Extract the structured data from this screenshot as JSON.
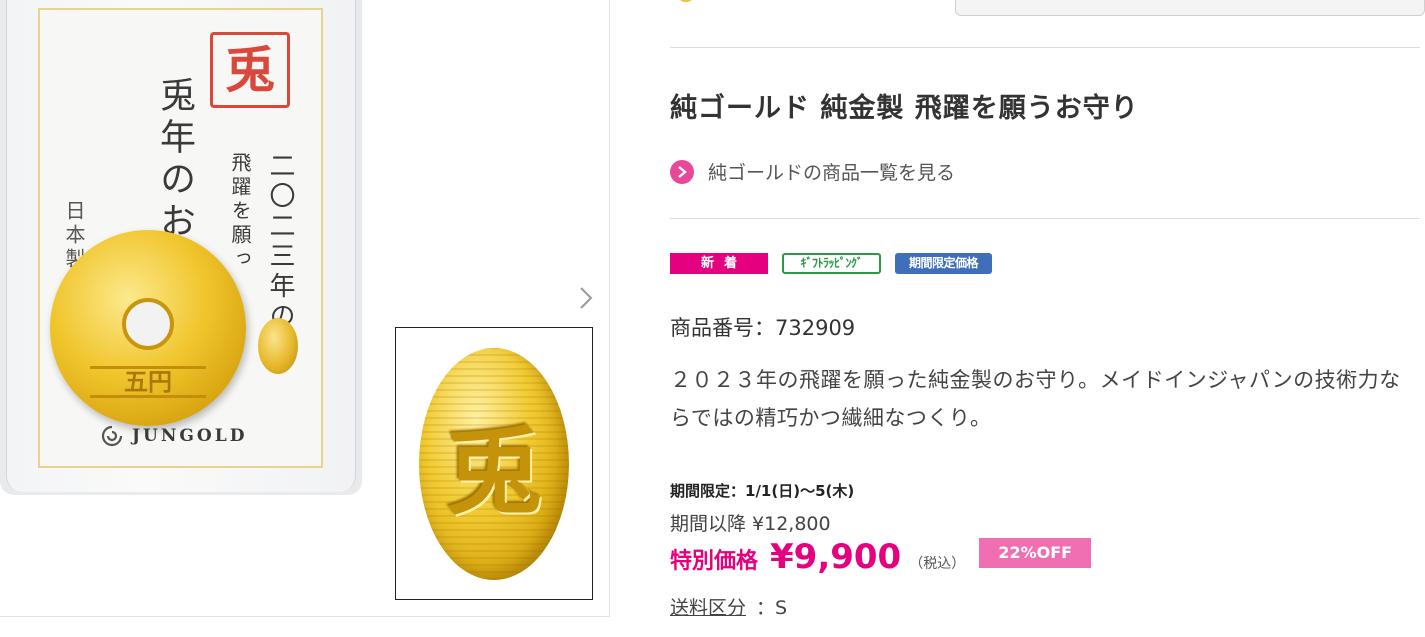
{
  "gallery": {
    "main_image": {
      "stamp_char": "兎",
      "title_vertical": "兎年のお",
      "year_vertical": "二〇二三年の",
      "wish_vertical": "飛躍を願っ",
      "maker_vertical": "日本製",
      "coin_text": "五円",
      "brand": "JUNGOLD"
    },
    "thumbnail": {
      "nugget_char": "兎"
    },
    "next_icon": "chevron-right-icon"
  },
  "product": {
    "title": "純ゴールド 純金製 飛躍を願うお守り",
    "category_link": "純ゴールドの商品一覧を見る",
    "badges": {
      "new": "新着",
      "gift": "ｷﾞﾌﾄﾗｯﾋﾟﾝｸﾞ",
      "limited": "期間限定価格"
    },
    "item_number": "商品番号：732909",
    "description": "２０２３年の飛躍を願った純金製のお守り。メイドインジャパンの技術力ならではの精巧かつ繊細なつくり。",
    "period": "期間限定：1/1(日)～5(木)",
    "after_period": "期間以降 ¥12,800",
    "special_label": "特別価格",
    "special_price": "¥9,900",
    "tax_note": "（税込）",
    "discount": "22%OFF",
    "shipping_label": "送料区分",
    "shipping_value": "：S"
  },
  "colors": {
    "accent_pink": "#e4007f",
    "gift_green": "#2a9a45",
    "limited_blue": "#3f6fb8",
    "off_pink": "#ef6fb2"
  }
}
